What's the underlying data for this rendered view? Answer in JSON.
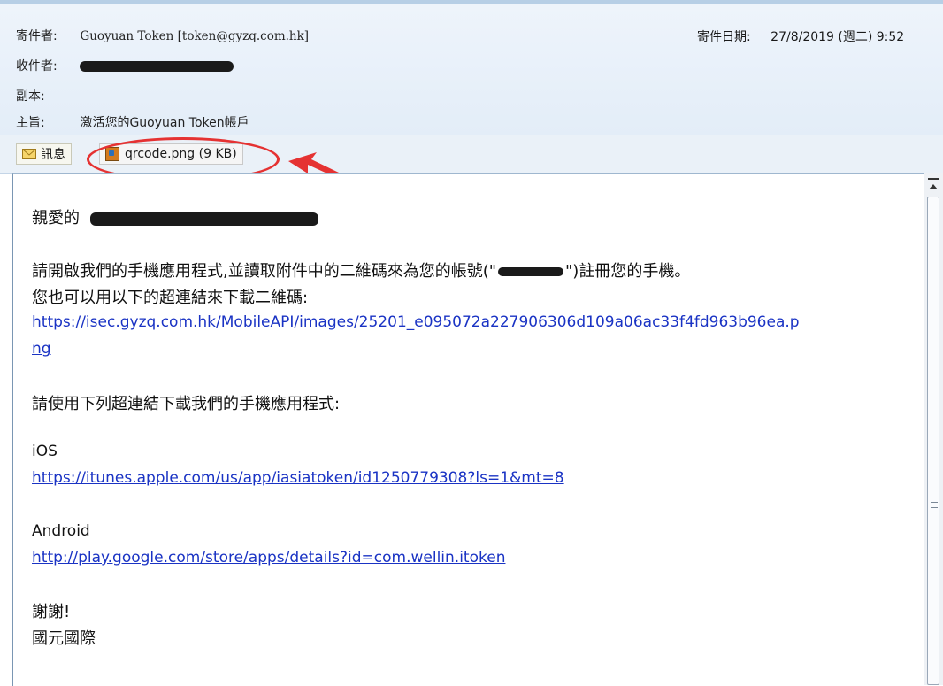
{
  "header": {
    "from_label": "寄件者:",
    "from_value": "Guoyuan Token [token@gyzq.com.hk]",
    "to_label": "收件者:",
    "cc_label": "副本:",
    "subject_label": "主旨:",
    "subject_value": "激活您的Guoyuan Token帳戶",
    "date_label": "寄件日期:",
    "date_value": "27/8/2019 (週二) 9:52"
  },
  "tabs": {
    "message_label": "訊息",
    "attachment_label": "qrcode.png (9 KB)"
  },
  "body": {
    "greeting": "親愛的",
    "para1_a": "請開啟我們的手機應用程式,並讀取附件中的二維碼來為您的帳號(\"",
    "para1_b": "\")註冊您的手機。",
    "para1_line2": "您也可以用以下的超連結來下載二維碼:",
    "qr_link_line1": "https://isec.gyzq.com.hk/MobileAPI/images/25201_e095072a227906306d109a06ac33f4fd963b96ea.p",
    "qr_link_line2": "ng",
    "para2": "請使用下列超連結下載我們的手機應用程式:",
    "ios_label": "iOS",
    "ios_link": "https://itunes.apple.com/us/app/iasiatoken/id1250779308?ls=1&mt=8",
    "android_label": "Android",
    "android_link": "http://play.google.com/store/apps/details?id=com.wellin.itoken",
    "thanks": "謝謝!",
    "signature": "國元國際"
  },
  "colors": {
    "link": "#1a33c4",
    "annotation": "#e53232"
  }
}
